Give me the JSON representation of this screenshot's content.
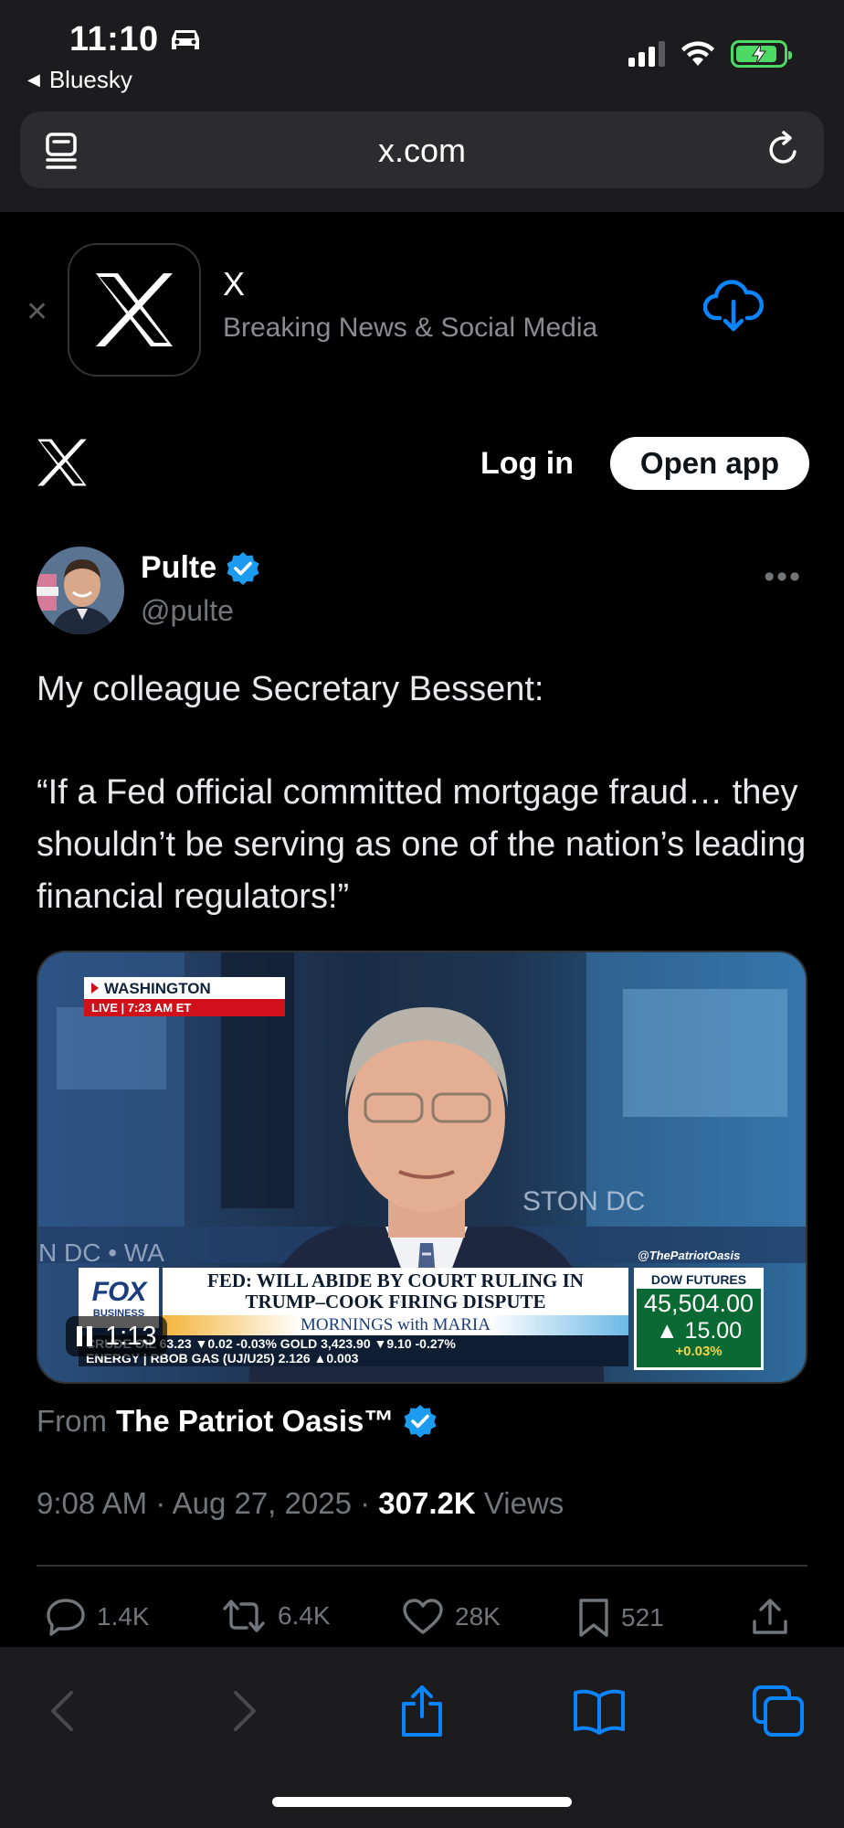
{
  "status_bar": {
    "time": "11:10",
    "back_app": "Bluesky"
  },
  "browser": {
    "url": "x.com"
  },
  "app_banner": {
    "name": "X",
    "subtitle": "Breaking News & Social Media"
  },
  "header": {
    "login_label": "Log in",
    "open_app_label": "Open app"
  },
  "tweet": {
    "author_name": "Pulte",
    "author_handle": "@pulte",
    "text_line1": "My colleague Secretary Bessent:",
    "text_quote": "“If a Fed official committed mortgage fraud… they shouldn’t be serving as one of the nation’s leading financial regulators!”",
    "video": {
      "location": "WASHINGTON",
      "live": "LIVE  |  7:23 AM ET",
      "channel": "FOX",
      "channel_sub": "BUSINESS",
      "headline_1": "FED: WILL ABIDE BY COURT RULING IN",
      "headline_2": "TRUMP–COOK FIRING DISPUTE",
      "show": "MORNINGS with MARIA",
      "ticker_row1": "CRUDE OIL   63.23 ▼0.02 -0.03%   GOLD   3,423.90 ▼9.10 -0.27%",
      "ticker_row2": "ENERGY   |  RBOB GAS (UJ/U25)  2.126 ▲0.003",
      "watermark": "@ThePatriotOasis",
      "dow_label": "DOW FUTURES",
      "dow_value": "45,504.00",
      "dow_change": "▲ 15.00",
      "dow_pct": "+0.03%",
      "bg_text": "N DC  •  WA",
      "bg_text_right": "STON DC",
      "timer": "1:13"
    },
    "from_label": "From",
    "from_source": "The Patriot Oasis™",
    "timestamp": "9:08 AM · Aug 27, 2025 ·",
    "views_count": "307.2K",
    "views_label": "Views",
    "actions": {
      "replies": "1.4K",
      "reposts": "6.4K",
      "likes": "28K",
      "bookmarks": "521"
    }
  },
  "colors": {
    "verified": "#1d9bf0",
    "safari_blue": "#0a84ff",
    "battery_green": "#4cd964"
  }
}
